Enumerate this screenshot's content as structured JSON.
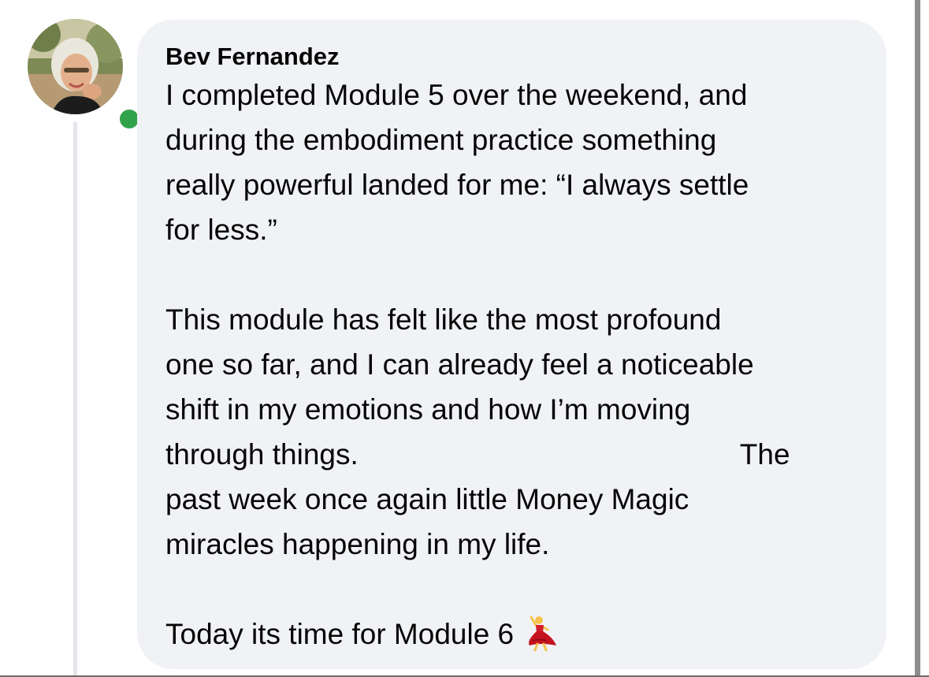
{
  "comment": {
    "author": "Bev Fernandez",
    "online": true,
    "paragraphs": [
      "I completed Module 5 over the weekend, and during the embodiment practice something really powerful landed for me: “I always settle for less.”",
      "This module has felt like the most profound one so far, and I can already feel a noticeable shift in my emotions and how I’m moving through things.",
      "Today its time for Module 6"
    ],
    "para2_lines": [
      "This module has felt like the most profound",
      "one so far, and I can already feel a noticeable",
      "shift in my emotions and how I’m moving",
      "through things.",
      "The",
      "past week once again little Money Magic",
      "miracles happening in my life."
    ],
    "para1_lines": [
      "I completed Module 5 over the weekend, and",
      "during the embodiment practice something",
      "really powerful landed for me: “I always settle",
      "for less.”"
    ],
    "last_line": "Today its time for Module 6",
    "emoji": "dancing-woman-emoji"
  },
  "colors": {
    "bubble": "#f0f2f5",
    "text": "#050505",
    "online": "#31a24c",
    "thread_line": "#e4e6eb"
  }
}
